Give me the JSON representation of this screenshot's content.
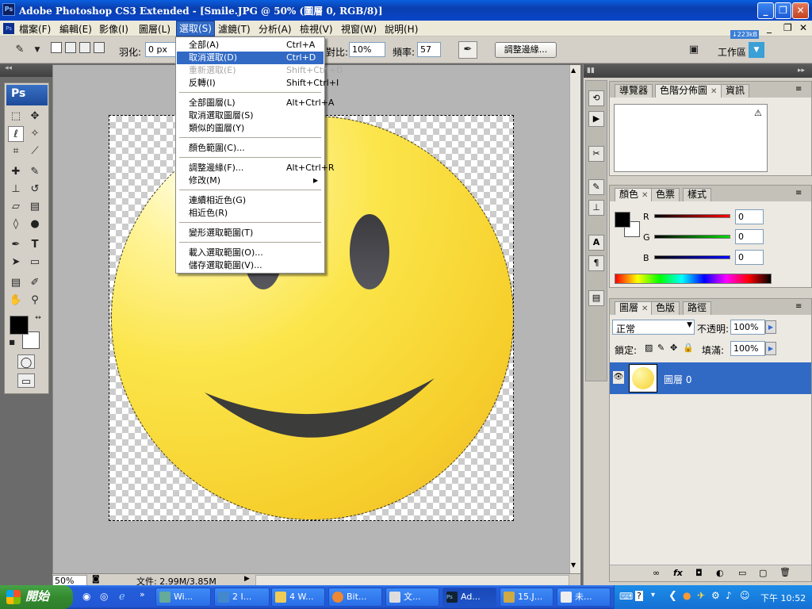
{
  "window": {
    "title": "Adobe Photoshop CS3 Extended - [Smile.JPG @ 50% (圖層 0, RGB/8)]",
    "ps_logo": "Ps"
  },
  "window_buttons": {
    "minimize": "_",
    "maximize": "❐",
    "close": "✕"
  },
  "menubar": {
    "items": [
      "檔案(F)",
      "編輯(E)",
      "影像(I)",
      "圖層(L)",
      "選取(S)",
      "濾鏡(T)",
      "分析(A)",
      "檢視(V)",
      "視窗(W)",
      "說明(H)"
    ],
    "doc_controls": [
      "_",
      "❐",
      "✕"
    ]
  },
  "options": {
    "feather_label": "羽化:",
    "feather_value": "0 px",
    "contrast_label": "對比:",
    "contrast_value": "10%",
    "freq_label": "頻率:",
    "freq_value": "57",
    "refine_button": "調整邊緣...",
    "workspace_label": "工作區",
    "memory_tip": "↓223kB"
  },
  "select_menu": {
    "items": [
      {
        "label": "全部(A)",
        "shortcut": "Ctrl+A",
        "state": "normal"
      },
      {
        "label": "取消選取(D)",
        "shortcut": "Ctrl+D",
        "state": "highlight"
      },
      {
        "label": "重新選取(E)",
        "shortcut": "Shift+Ctrl+D",
        "state": "disabled"
      },
      {
        "label": "反轉(I)",
        "shortcut": "Shift+Ctrl+I",
        "state": "normal"
      },
      {
        "label": "全部圖層(L)",
        "shortcut": "Alt+Ctrl+A",
        "state": "normal"
      },
      {
        "label": "取消選取圖層(S)",
        "shortcut": "",
        "state": "normal"
      },
      {
        "label": "類似的圖層(Y)",
        "shortcut": "",
        "state": "normal"
      },
      {
        "label": "顏色範圍(C)...",
        "shortcut": "",
        "state": "normal"
      },
      {
        "label": "調整邊緣(F)...",
        "shortcut": "Alt+Ctrl+R",
        "state": "normal"
      },
      {
        "label": "修改(M)",
        "shortcut": "",
        "state": "submenu"
      },
      {
        "label": "連續相近色(G)",
        "shortcut": "",
        "state": "normal"
      },
      {
        "label": "相近色(R)",
        "shortcut": "",
        "state": "normal"
      },
      {
        "label": "變形選取範圍(T)",
        "shortcut": "",
        "state": "normal"
      },
      {
        "label": "載入選取範圍(O)...",
        "shortcut": "",
        "state": "normal"
      },
      {
        "label": "儲存選取範圍(V)...",
        "shortcut": "",
        "state": "normal"
      }
    ]
  },
  "status": {
    "zoom": "50%",
    "doc_info": "文件: 2.99M/3.85M"
  },
  "panels": {
    "navigator_tabs": [
      "導覽器",
      "色階分佈圖",
      "資訊"
    ],
    "color_tabs": [
      "顏色",
      "色票",
      "樣式"
    ],
    "color_channels": [
      {
        "label": "R",
        "value": "0"
      },
      {
        "label": "G",
        "value": "0"
      },
      {
        "label": "B",
        "value": "0"
      }
    ],
    "layer_tabs": [
      "圖層",
      "色版",
      "路徑"
    ],
    "blend_mode": "正常",
    "opacity_label": "不透明:",
    "opacity_value": "100%",
    "lock_label": "鎖定:",
    "fill_label": "填滿:",
    "fill_value": "100%",
    "layer_name": "圖層 0",
    "footer_icons": [
      "∞",
      "fx",
      "◘",
      "◐",
      "▭",
      "▢",
      "🗑"
    ]
  },
  "taskbar": {
    "start": "開始",
    "tasks": [
      "Wi...",
      "2 I...",
      "4 W...",
      "Bit...",
      "文...",
      "Ad...",
      "15.J...",
      "未..."
    ],
    "clock": "下午 10:52"
  },
  "colors": {
    "accent": "#316ac5",
    "title_blue": "#0a4fd0",
    "face": "#f7d63a",
    "start_green": "#36902f"
  }
}
